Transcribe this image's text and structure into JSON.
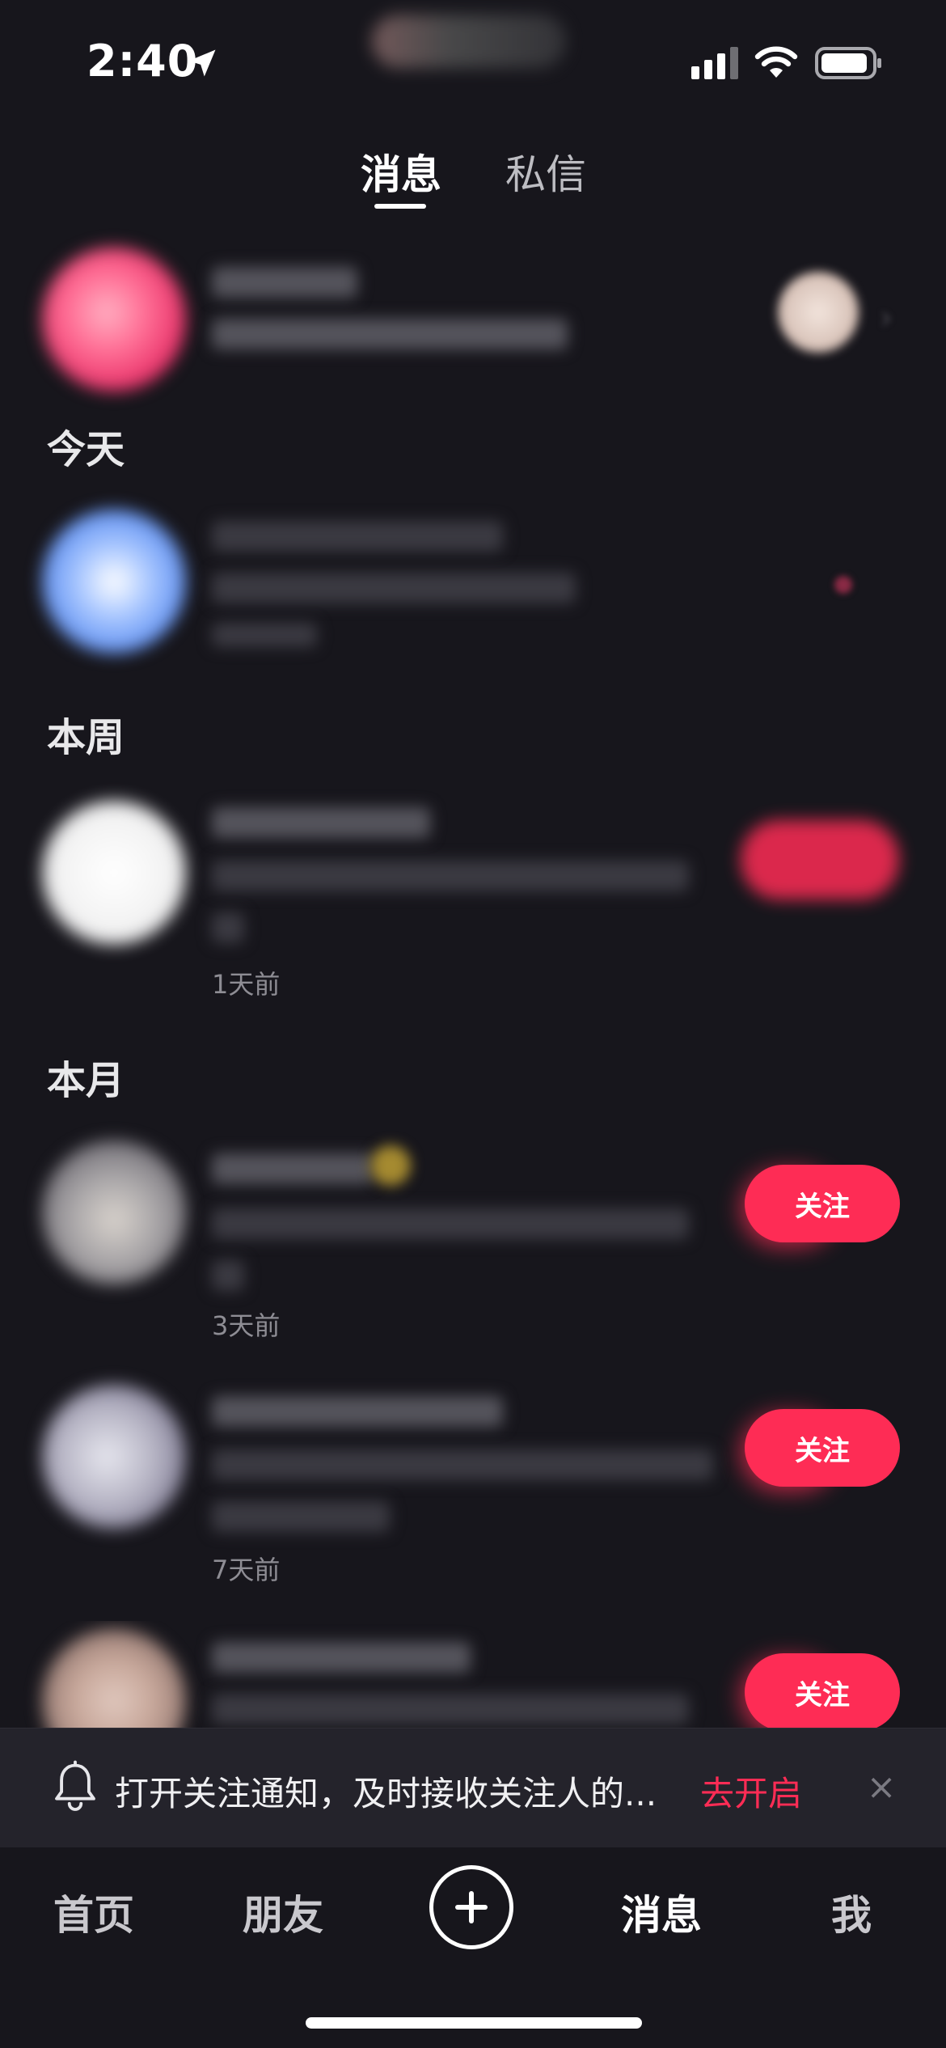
{
  "status_bar": {
    "time": "2:40"
  },
  "tabs": [
    {
      "label": "消息",
      "active": true
    },
    {
      "label": "私信",
      "active": false
    }
  ],
  "sections": {
    "today": "今天",
    "this_week": "本周",
    "this_month": "本月"
  },
  "timestamps": {
    "week_row": "1天前",
    "month_row_1": "3天前",
    "month_row_2": "7天前"
  },
  "follow_buttons": [
    "关注",
    "关注",
    "关注"
  ],
  "banner": {
    "text": "打开关注通知，及时接收关注人的...",
    "action": "去开启",
    "close_icon": "×"
  },
  "bottom_nav": [
    {
      "label": "首页",
      "active": false
    },
    {
      "label": "朋友",
      "active": false
    },
    {
      "label": "+",
      "icon": "plus-icon"
    },
    {
      "label": "消息",
      "active": true
    },
    {
      "label": "我",
      "active": false
    }
  ],
  "colors": {
    "background": "#17161c",
    "accent": "#fe2c55",
    "banner_bg": "#24232b"
  }
}
